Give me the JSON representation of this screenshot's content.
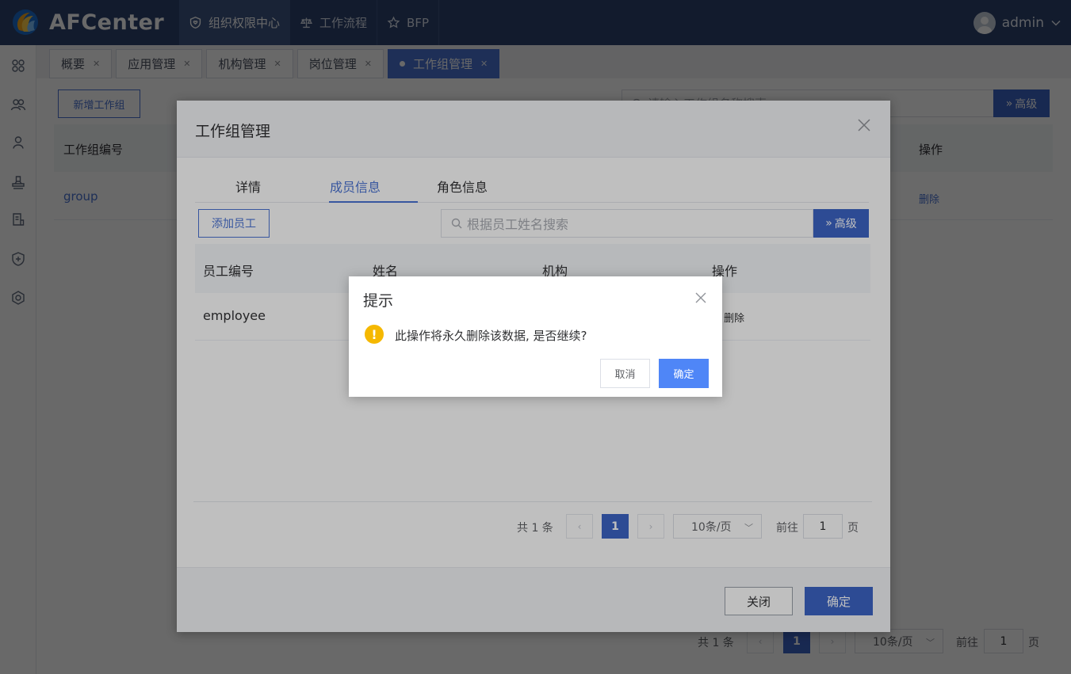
{
  "header": {
    "brand": "AFCenter",
    "nav": [
      {
        "label": "组织权限中心",
        "active": true
      },
      {
        "label": "工作流程",
        "active": false
      },
      {
        "label": "BFP",
        "active": false
      }
    ],
    "user": "admin"
  },
  "tabs": [
    {
      "label": "概要"
    },
    {
      "label": "应用管理"
    },
    {
      "label": "机构管理"
    },
    {
      "label": "岗位管理"
    },
    {
      "label": "工作组管理"
    }
  ],
  "page": {
    "add_button": "新增工作组",
    "search_placeholder": "请输入工作组名称搜索",
    "advanced": "高级",
    "col_code": "工作组编号",
    "col_action": "操作",
    "row_code": "group",
    "row_delete": "删除",
    "total": "共 1 条",
    "current_page": "1",
    "page_size": "10条/页",
    "goto": "前往",
    "goto_value": "1",
    "page_unit": "页"
  },
  "dialog": {
    "title": "工作组管理",
    "tabs": [
      "详情",
      "成员信息",
      "角色信息"
    ],
    "add_button": "添加员工",
    "search_placeholder": "根据员工姓名搜索",
    "advanced": "高级",
    "columns": [
      "员工编号",
      "姓名",
      "机构",
      "操作"
    ],
    "row_code": "employee",
    "row_delete": "删除",
    "total": "共 1 条",
    "current_page": "1",
    "page_size": "10条/页",
    "goto": "前往",
    "goto_value": "1",
    "page_unit": "页",
    "close_button": "关闭",
    "confirm_button": "确定"
  },
  "confirm": {
    "title": "提示",
    "icon": "!",
    "message": "此操作将永久删除该数据, 是否继续?",
    "cancel": "取消",
    "ok": "确定"
  },
  "colors": {
    "header_bg": "#2f4470",
    "accent": "#4a73d4",
    "warning": "#f5b800"
  }
}
